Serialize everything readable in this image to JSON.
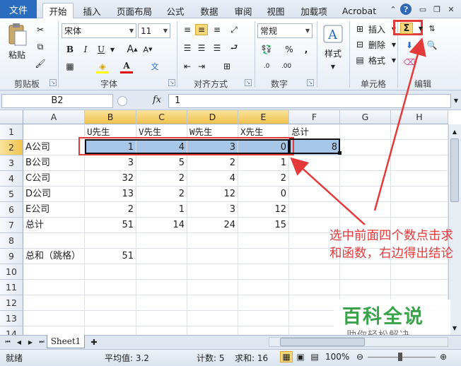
{
  "menu": {
    "file": "文件",
    "tabs": [
      "开始",
      "插入",
      "页面布局",
      "公式",
      "数据",
      "审阅",
      "视图",
      "加载项",
      "Acrobat"
    ]
  },
  "ribbon": {
    "clipboard": {
      "paste": "粘贴",
      "label": "剪贴板"
    },
    "font": {
      "name": "宋体",
      "size": "11",
      "label": "字体"
    },
    "alignment": {
      "label": "对齐方式"
    },
    "number": {
      "format": "常规",
      "label": "数字"
    },
    "styles": {
      "label": "样式"
    },
    "cells": {
      "insert": "插入",
      "delete": "删除",
      "format": "格式",
      "label": "单元格"
    },
    "editing": {
      "label": "编辑",
      "autosum": "Σ"
    }
  },
  "formula_bar": {
    "name_box": "B2",
    "fx": "fx",
    "value": "1"
  },
  "columns": [
    "A",
    "B",
    "C",
    "D",
    "E",
    "F",
    "G",
    "H"
  ],
  "rows": [
    "1",
    "2",
    "3",
    "4",
    "5",
    "6",
    "7",
    "8",
    "9",
    "10",
    "11",
    "12",
    "13",
    "14",
    "15"
  ],
  "cells": {
    "r1": [
      "",
      "U先生",
      "V先生",
      "W先生",
      "X先生",
      "总计"
    ],
    "r2": [
      "A公司",
      "1",
      "4",
      "3",
      "0",
      "8"
    ],
    "r3": [
      "B公司",
      "3",
      "5",
      "2",
      "1",
      ""
    ],
    "r4": [
      "C公司",
      "32",
      "2",
      "4",
      "2",
      ""
    ],
    "r5": [
      "D公司",
      "13",
      "2",
      "12",
      "0",
      ""
    ],
    "r6": [
      "E公司",
      "2",
      "1",
      "3",
      "12",
      ""
    ],
    "r7": [
      "总计",
      "51",
      "14",
      "24",
      "15",
      ""
    ],
    "r9": [
      "总和（跳格）",
      "51"
    ]
  },
  "sheet_tab": "Sheet1",
  "status": {
    "ready": "就绪",
    "average": "平均值: 3.2",
    "count": "计数: 5",
    "sum": "求和: 16",
    "zoom": "100%"
  },
  "annotation": "选中前面四个数点击求和函数，右边得出结论",
  "watermark": {
    "title": "百科全说",
    "subtitle": "助你轻松解决"
  },
  "colors": {
    "annotation": "#e43a3a",
    "selection": "#a8c6e8",
    "file_tab": "#2a6cc0"
  }
}
